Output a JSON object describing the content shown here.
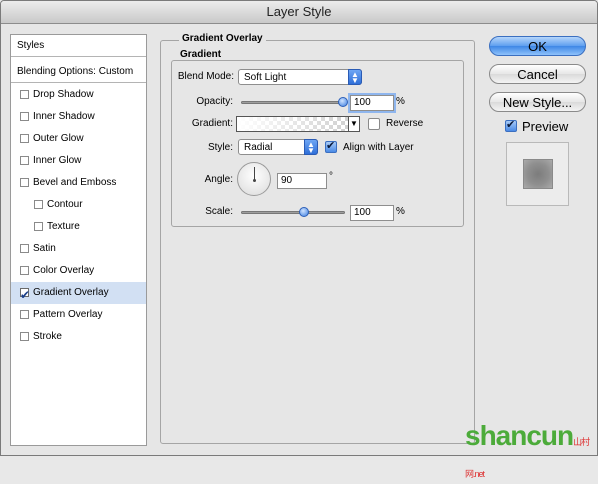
{
  "window": {
    "title": "Layer Style"
  },
  "sidebar": {
    "styles_label": "Styles",
    "blending_label": "Blending Options: Custom",
    "items": [
      {
        "label": "Drop Shadow",
        "checked": false
      },
      {
        "label": "Inner Shadow",
        "checked": false
      },
      {
        "label": "Outer Glow",
        "checked": false
      },
      {
        "label": "Inner Glow",
        "checked": false
      },
      {
        "label": "Bevel and Emboss",
        "checked": false
      },
      {
        "label": "Contour",
        "checked": false
      },
      {
        "label": "Texture",
        "checked": false
      },
      {
        "label": "Satin",
        "checked": false
      },
      {
        "label": "Color Overlay",
        "checked": false
      },
      {
        "label": "Gradient Overlay",
        "checked": true,
        "selected": true
      },
      {
        "label": "Pattern Overlay",
        "checked": false
      },
      {
        "label": "Stroke",
        "checked": false
      }
    ]
  },
  "panel": {
    "title": "Gradient Overlay",
    "group_title": "Gradient",
    "blend_mode_label": "Blend Mode:",
    "blend_mode_value": "Soft Light",
    "opacity_label": "Opacity:",
    "opacity_value": "100",
    "opacity_unit": "%",
    "gradient_label": "Gradient:",
    "reverse_label": "Reverse",
    "reverse_checked": false,
    "style_label": "Style:",
    "style_value": "Radial",
    "align_label": "Align with Layer",
    "align_checked": true,
    "angle_label": "Angle:",
    "angle_value": "90",
    "angle_unit": "°",
    "scale_label": "Scale:",
    "scale_value": "100",
    "scale_unit": "%"
  },
  "buttons": {
    "ok": "OK",
    "cancel": "Cancel",
    "new_style": "New Style...",
    "preview_label": "Preview",
    "preview_checked": true
  },
  "watermark": {
    "text": "shancun",
    "sub": "山村网",
    "net": ".net"
  }
}
